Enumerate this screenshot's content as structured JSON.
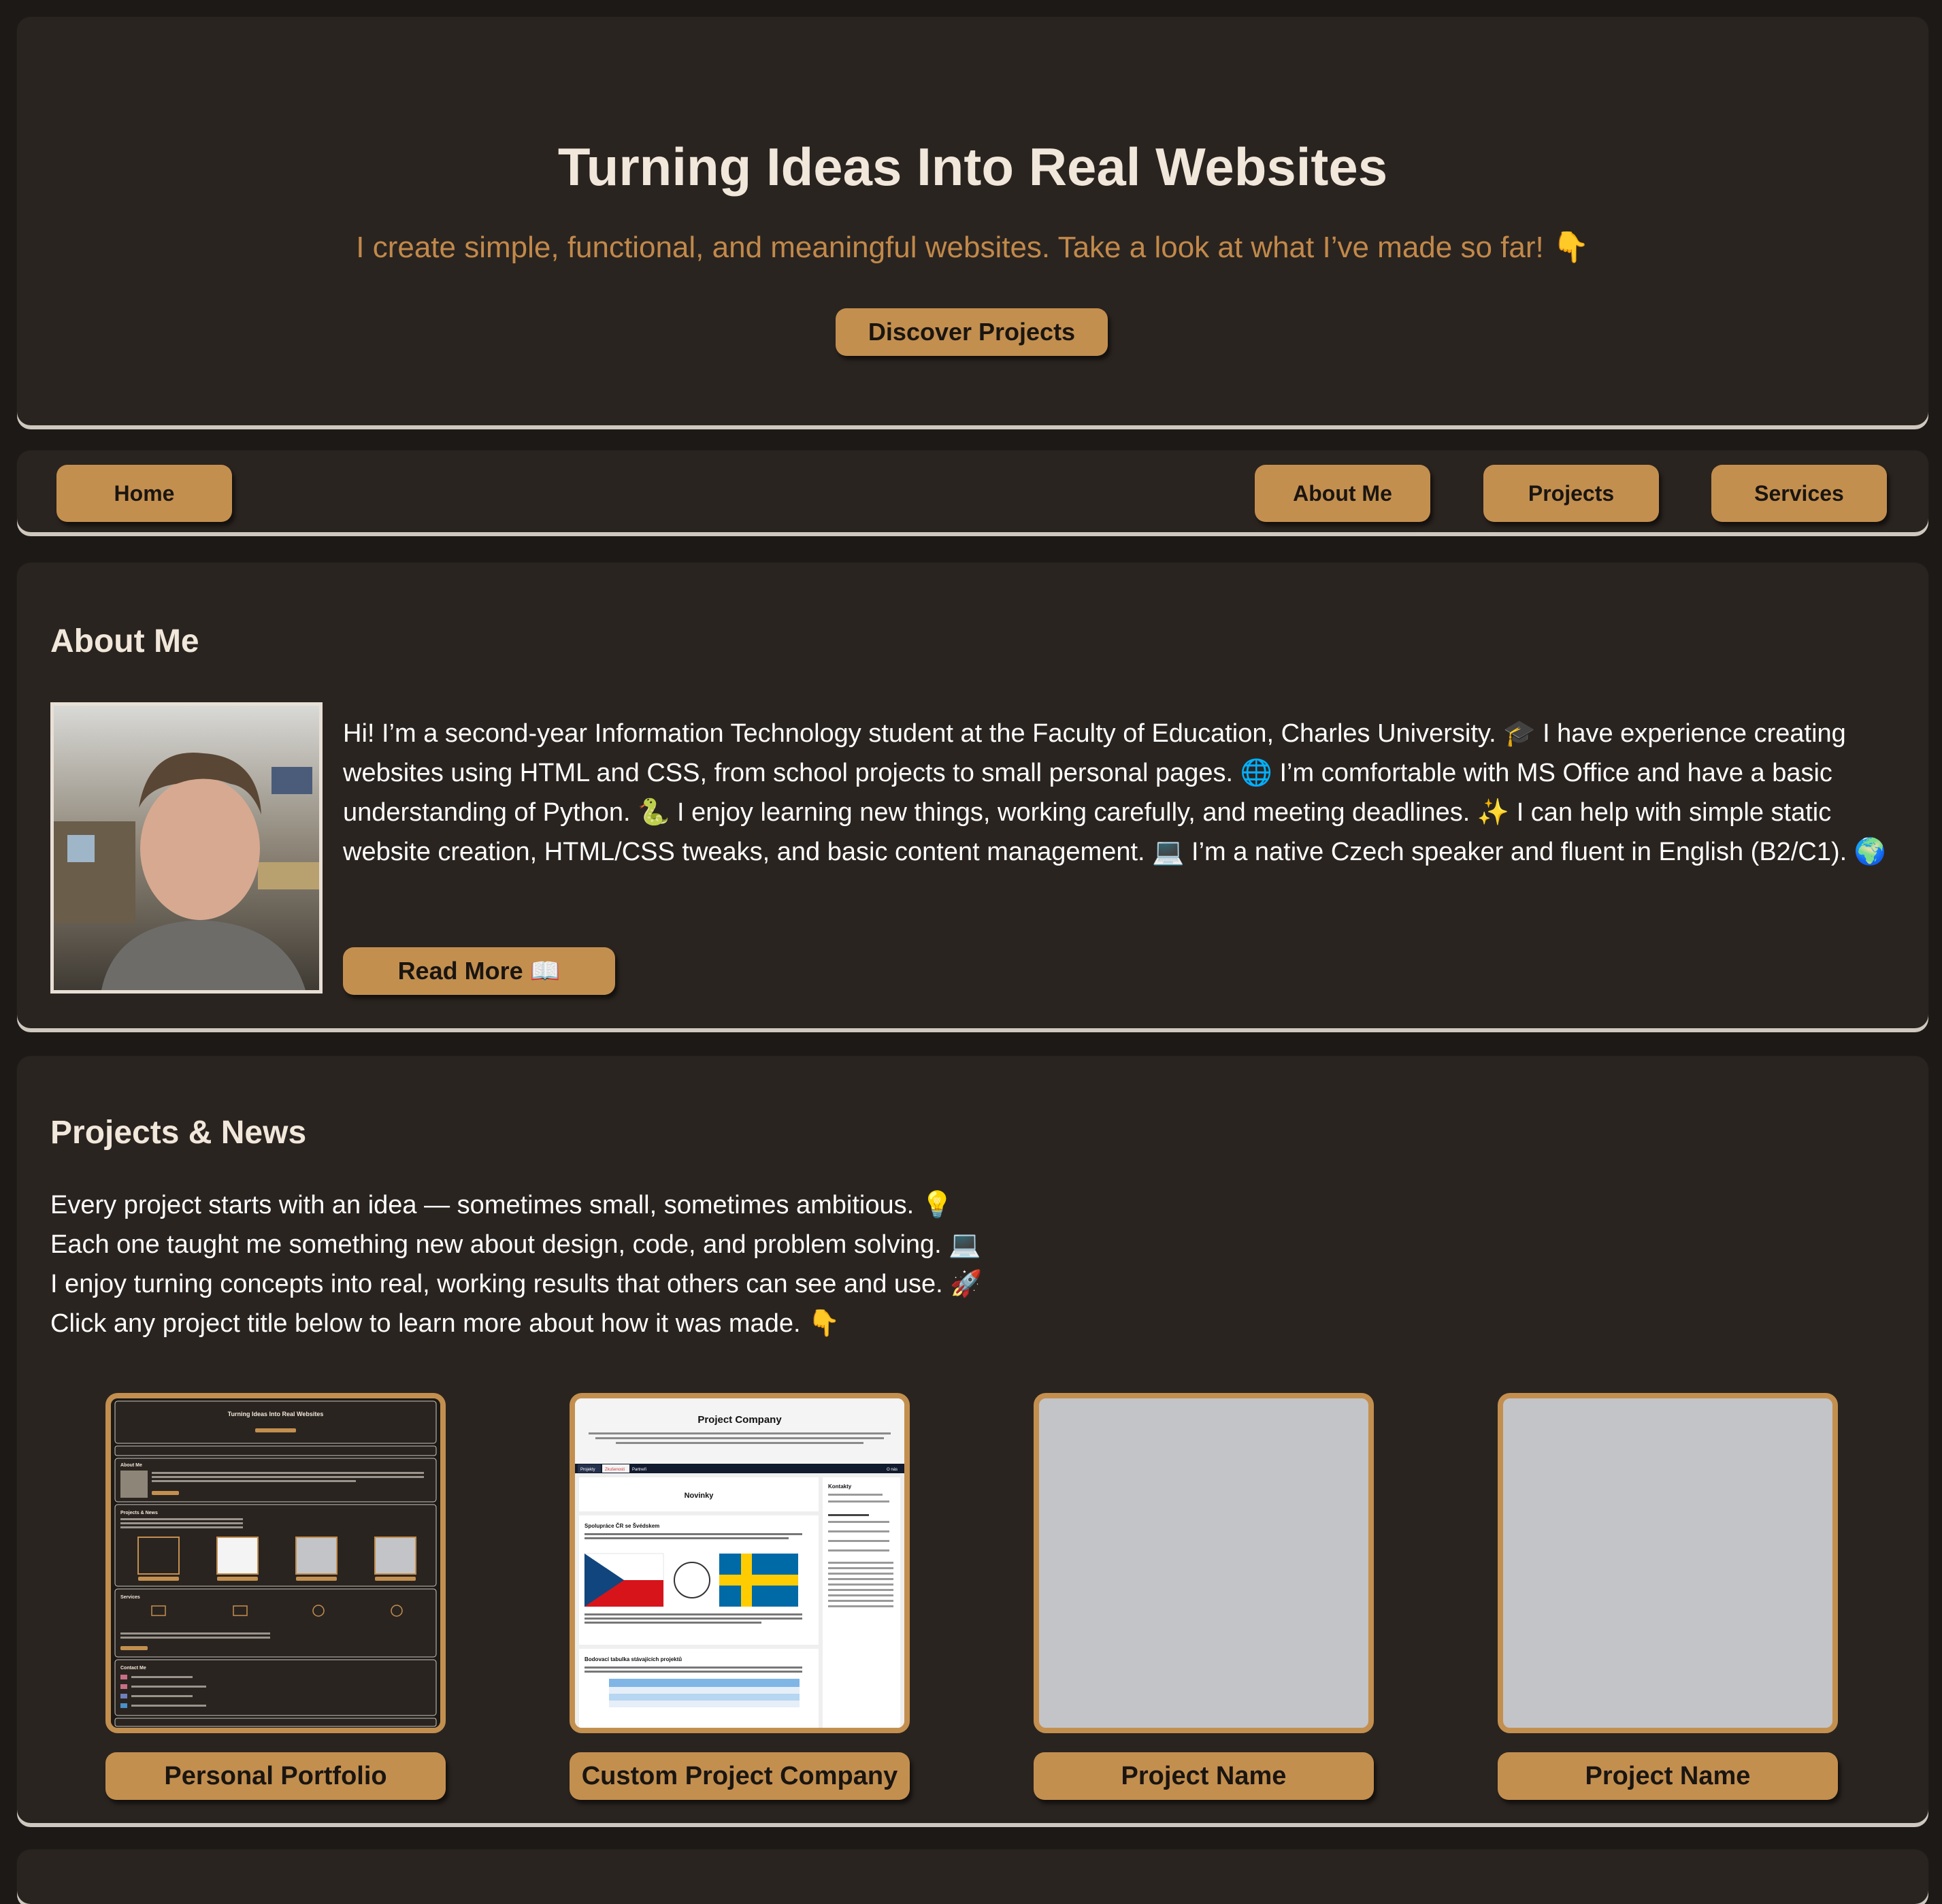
{
  "hero": {
    "title": "Turning Ideas Into Real Websites",
    "subtitle": "I create simple, functional, and meaningful websites. Take a look at what I’ve made so far! 👇",
    "button_label": "Discover Projects"
  },
  "nav": {
    "home": "Home",
    "about": "About Me",
    "projects": "Projects",
    "services": "Services"
  },
  "about": {
    "title": "About Me",
    "text": "Hi! I’m a second-year Information Technology student at the Faculty of Education, Charles University. 🎓 I have experience creating websites using HTML and CSS, from school projects to small personal pages. 🌐 I’m comfortable with MS Office and have a basic understanding of Python. 🐍 I enjoy learning new things, working carefully, and meeting deadlines. ✨ I can help with simple static website creation, HTML/CSS tweaks, and basic content management. 💻 I’m a native Czech speaker and fluent in English (B2/C1). 🌍",
    "button_label": "Read More 📖"
  },
  "projects": {
    "title": "Projects & News",
    "intro": [
      "Every project starts with an idea — sometimes small, sometimes ambitious. 💡",
      "Each one taught me something new about design, code, and problem solving. 💻",
      "I enjoy turning concepts into real, working results that others can see and use. 🚀",
      "Click any project title below to learn more about how it was made. 👇"
    ],
    "items": [
      {
        "label": "Personal Portfolio"
      },
      {
        "label": "Custom Project Company"
      },
      {
        "label": "Project Name"
      },
      {
        "label": "Project Name"
      }
    ]
  },
  "thumbnails": {
    "portfolio": {
      "title": "Turning Ideas Into Real Websites",
      "sections": [
        "About Me",
        "Projects & News",
        "Services",
        "Contact Me"
      ]
    },
    "company": {
      "title": "Project Company",
      "tabs": [
        "Projekty",
        "Zkušenosti",
        "Partneři",
        "O nás"
      ],
      "news_heading": "Novinky",
      "contacts_heading": "Kontakty",
      "article_title": "Spolupráce ČR se Švédskem",
      "table_title": "Bodovací tabulka stávajících projektů"
    }
  },
  "colors": {
    "background": "#1c1916",
    "card": "#2a2420",
    "accent": "#c38f4f",
    "subtitle": "#c2894a",
    "heading": "#f1e7da"
  }
}
